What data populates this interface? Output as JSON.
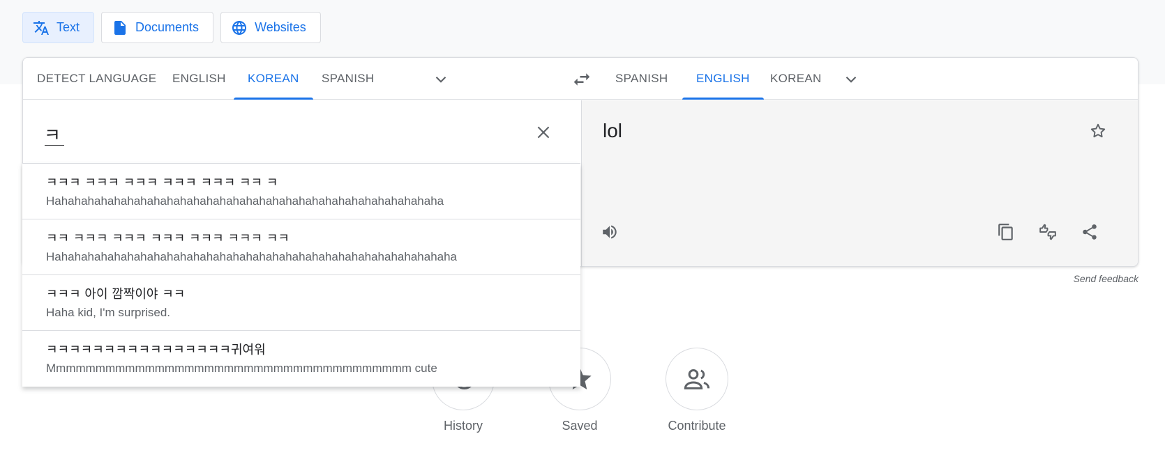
{
  "mode_tabs": [
    {
      "label": "Text",
      "icon": "translate-icon",
      "active": true
    },
    {
      "label": "Documents",
      "icon": "document-icon",
      "active": false
    },
    {
      "label": "Websites",
      "icon": "globe-icon",
      "active": false
    }
  ],
  "source_langs": [
    {
      "label": "DETECT LANGUAGE",
      "active": false
    },
    {
      "label": "ENGLISH",
      "active": false
    },
    {
      "label": "KOREAN",
      "active": true
    },
    {
      "label": "SPANISH",
      "active": false
    }
  ],
  "target_langs": [
    {
      "label": "SPANISH",
      "active": false
    },
    {
      "label": "ENGLISH",
      "active": true
    },
    {
      "label": "KOREAN",
      "active": false
    }
  ],
  "source": {
    "text": "ㅋ"
  },
  "target": {
    "text": "lol"
  },
  "suggestions": [
    {
      "source": "ㅋㅋㅋ ㅋㅋㅋ ㅋㅋㅋ ㅋㅋㅋ ㅋㅋㅋ ㅋㅋ ㅋ",
      "translation": "Hahahahahahahahahahahahahahahahahahahahahahahahahahahahahaha"
    },
    {
      "source": "ㅋㅋ ㅋㅋㅋ ㅋㅋㅋ ㅋㅋㅋ ㅋㅋㅋ ㅋㅋㅋ ㅋㅋ",
      "translation": "Hahahahahahahahahahahahahahahahahahahahahahahahahahahahahahaha"
    },
    {
      "source": "ㅋㅋㅋ 아이 깜짝이야 ㅋㅋ",
      "translation": "Haha kid, I'm surprised."
    },
    {
      "source": "ㅋㅋㅋㅋㅋㅋㅋㅋㅋㅋㅋㅋㅋㅋㅋㅋ귀여워",
      "translation": "Mmmmmmmmmmmmmmmmmmmmmmmmmmmmmmmmmmmmm cute"
    }
  ],
  "feedback": {
    "label": "Send feedback"
  },
  "bottom_actions": [
    {
      "label": "History",
      "icon": "history-icon"
    },
    {
      "label": "Saved",
      "icon": "star-icon"
    },
    {
      "label": "Contribute",
      "icon": "people-icon"
    }
  ],
  "colors": {
    "accent": "#1a73e8",
    "muted": "#5f6368",
    "border": "#dadce0"
  }
}
